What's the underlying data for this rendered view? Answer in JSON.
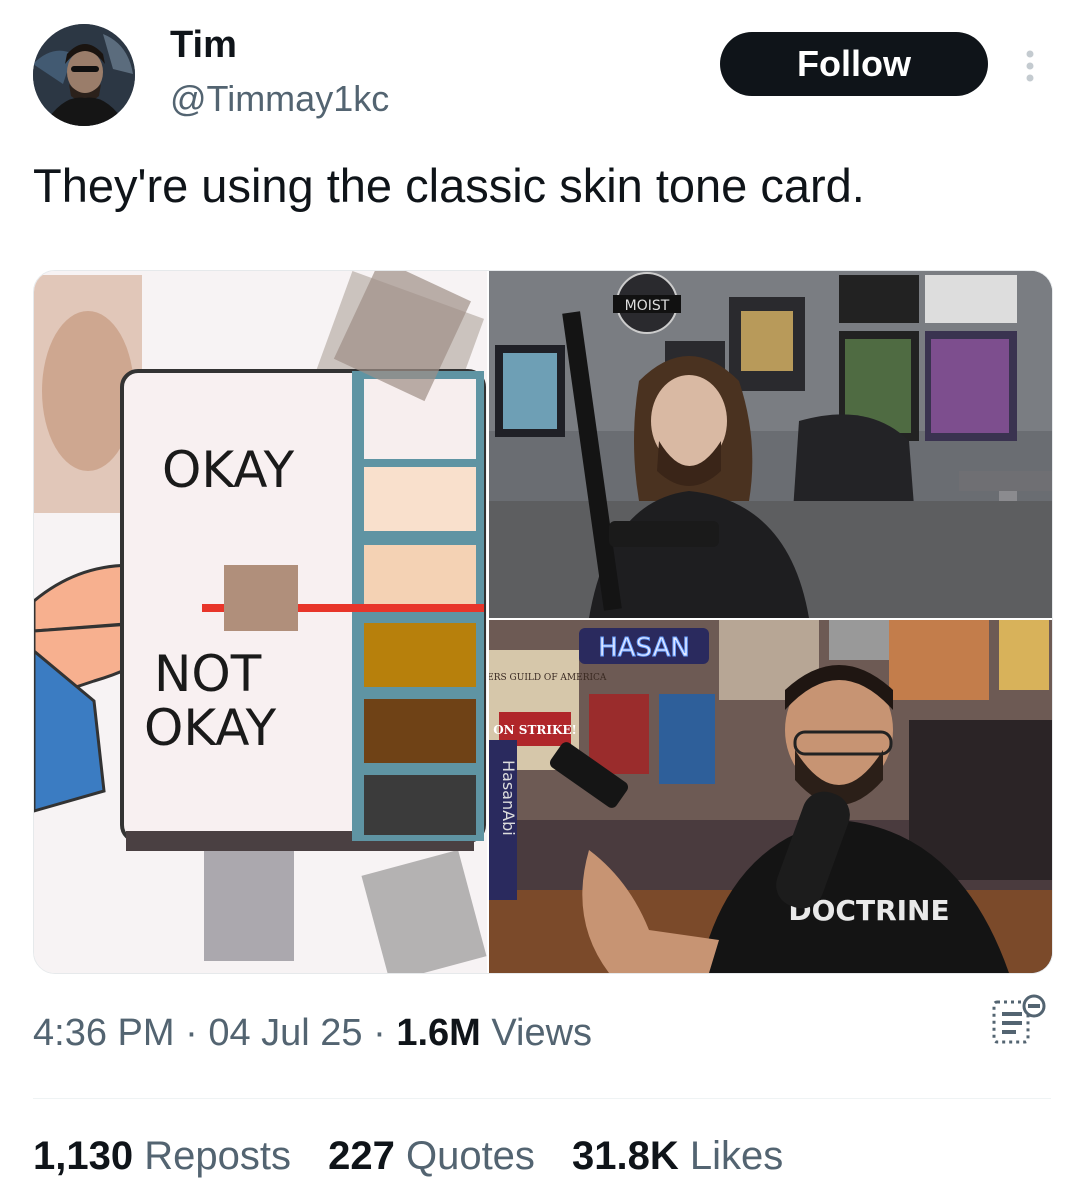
{
  "author": {
    "name": "Tim",
    "handle": "@Timmay1kc",
    "avatar_icon": "user-avatar"
  },
  "actions": {
    "follow_label": "Follow",
    "more_icon": "more-vertical-icon"
  },
  "tweet": {
    "text": "They're using the classic skin tone card."
  },
  "media": {
    "meme_card_top_label": "OKAY",
    "meme_card_bottom_label_line1": "NOT",
    "meme_card_bottom_label_line2": "OKAY",
    "stream_top_sign": "MOIST",
    "stream_bottom_sign": "HASAN",
    "stream_bottom_sign_writers": "WRITERS GUILD OF AMERICA",
    "stream_bottom_sign_strike": "ON STRIKE!",
    "stream_bottom_vertical": "HasanAbi",
    "stream_bottom_shirt": "DOCTRINE",
    "swatch_colors": [
      "#f9e0cc",
      "#f4d2b4",
      "#b7800c",
      "#6f4216",
      "#3b3b3b"
    ],
    "accent_line_color": "#e8352a"
  },
  "meta": {
    "time": "4:36 PM",
    "sep1": " · ",
    "date": "04 Jul 25",
    "sep2": " · ",
    "views_count": "1.6M",
    "views_label": " Views",
    "analytics_icon": "analytics-icon"
  },
  "stats": {
    "reposts_count": "1,130",
    "reposts_label": " Reposts",
    "quotes_count": "227",
    "quotes_label": " Quotes",
    "likes_count": "31.8K",
    "likes_label": " Likes"
  },
  "colors": {
    "text_primary": "#0f1419",
    "text_secondary": "#536471",
    "follow_bg": "#0f1419"
  }
}
